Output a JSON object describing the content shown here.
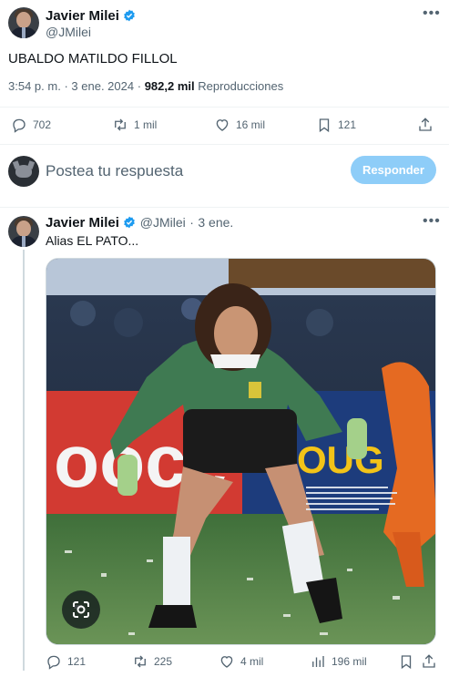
{
  "main_tweet": {
    "author_name": "Javier Milei",
    "handle": "@JMilei",
    "text": "UBALDO MATILDO FILLOL",
    "time": "3:54 p. m.",
    "separator": "·",
    "date": "3 ene. 2024",
    "views_count": "982,2 mil",
    "views_label": "Reproducciones",
    "actions": {
      "replies": "702",
      "retweets": "1 mil",
      "likes": "16 mil",
      "bookmarks": "121"
    }
  },
  "reply_composer": {
    "placeholder": "Postea tu respuesta",
    "button": "Responder"
  },
  "reply_tweet": {
    "author_name": "Javier Milei",
    "handle": "@JMilei",
    "separator": "·",
    "date": "3 ene.",
    "text": "Alias EL PATO...",
    "photo_sign": "ooce",
    "photo_sign_right": "OUG",
    "actions": {
      "replies": "121",
      "retweets": "225",
      "likes": "4 mil",
      "views": "196 mil"
    }
  },
  "colors": {
    "accent": "#1d9bf0",
    "button_disabled": "#8ecdf8",
    "text_secondary": "#536471"
  }
}
